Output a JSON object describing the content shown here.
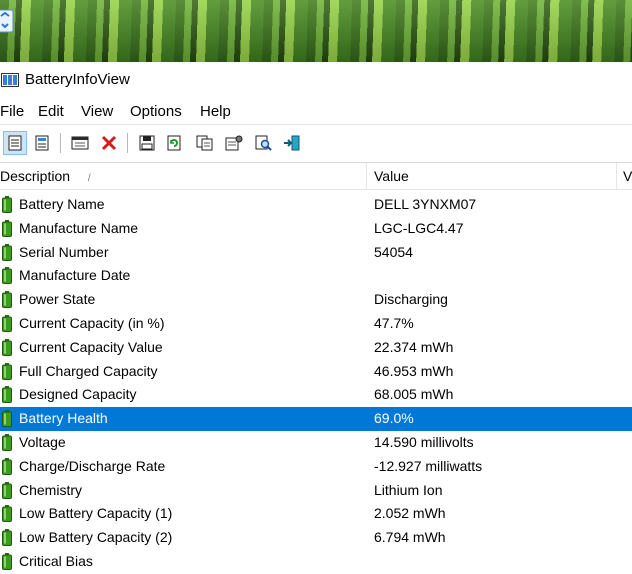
{
  "window": {
    "title": "BatteryInfoView"
  },
  "menu": [
    "File",
    "Edit",
    "View",
    "Options",
    "Help"
  ],
  "toolbar": {
    "buttons": [
      {
        "name": "view-list-icon"
      },
      {
        "name": "view-details-icon"
      },
      {
        "name": "properties-window-icon"
      },
      {
        "name": "delete-icon"
      },
      {
        "name": "save-icon"
      },
      {
        "name": "refresh-icon"
      },
      {
        "name": "copy-icon"
      },
      {
        "name": "options-icon"
      },
      {
        "name": "find-icon"
      },
      {
        "name": "exit-icon"
      }
    ]
  },
  "table": {
    "columns": [
      "Description",
      "Value",
      "V"
    ],
    "sort_indicator": "/",
    "rows": [
      {
        "description": "Battery Name",
        "value": "DELL 3YNXM07"
      },
      {
        "description": "Manufacture Name",
        "value": "LGC-LGC4.47"
      },
      {
        "description": "Serial Number",
        "value": "54054"
      },
      {
        "description": "Manufacture Date",
        "value": ""
      },
      {
        "description": "Power State",
        "value": "Discharging"
      },
      {
        "description": "Current Capacity (in %)",
        "value": "47.7%"
      },
      {
        "description": "Current Capacity Value",
        "value": "22.374 mWh"
      },
      {
        "description": "Full Charged Capacity",
        "value": "46.953 mWh"
      },
      {
        "description": "Designed Capacity",
        "value": "68.005 mWh"
      },
      {
        "description": "Battery Health",
        "value": "69.0%",
        "selected": true
      },
      {
        "description": "Voltage",
        "value": "14.590 millivolts"
      },
      {
        "description": "Charge/Discharge Rate",
        "value": "-12.927 milliwatts"
      },
      {
        "description": "Chemistry",
        "value": "Lithium Ion"
      },
      {
        "description": "Low Battery Capacity (1)",
        "value": "2.052 mWh"
      },
      {
        "description": "Low Battery Capacity (2)",
        "value": "6.794 mWh"
      },
      {
        "description": "Critical Bias",
        "value": ""
      }
    ]
  },
  "colors": {
    "selection": "#0078d7",
    "battery_icon": "#3c9b21"
  }
}
